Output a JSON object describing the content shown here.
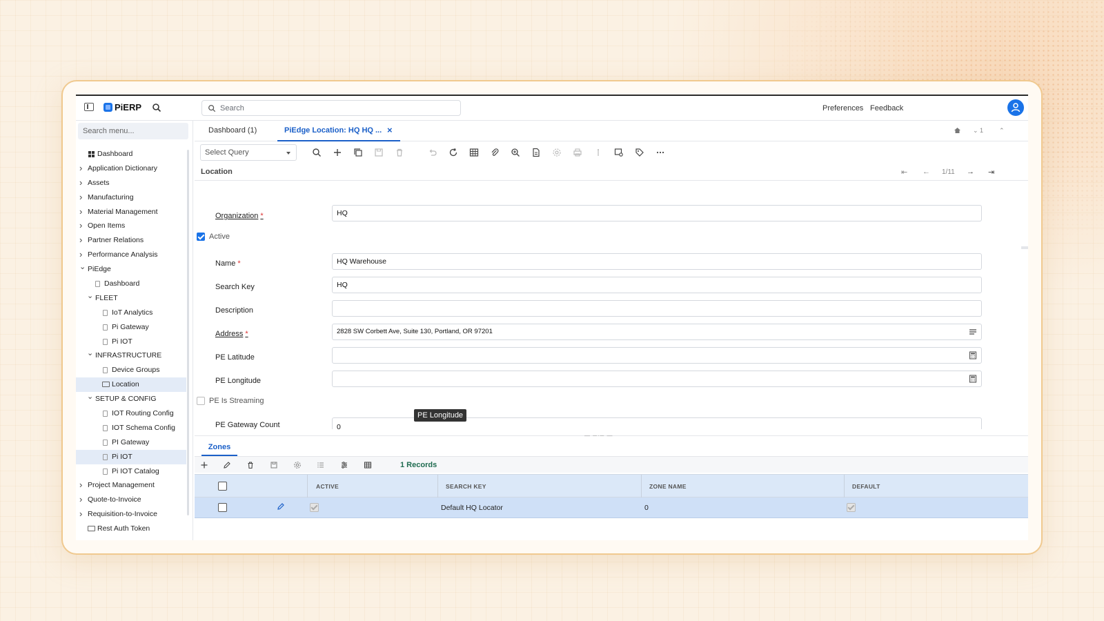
{
  "app": {
    "name": "PiERP"
  },
  "topbar": {
    "search_placeholder": "Search",
    "preferences": "Preferences",
    "feedback": "Feedback"
  },
  "sidebar": {
    "search_placeholder": "Search menu...",
    "items": [
      {
        "label": "Dashboard",
        "level": 0,
        "icon": "grid-icon"
      },
      {
        "label": "Application Dictionary",
        "level": 0,
        "icon": "chevron-right-icon"
      },
      {
        "label": "Assets",
        "level": 0,
        "icon": "chevron-right-icon"
      },
      {
        "label": "Manufacturing",
        "level": 0,
        "icon": "chevron-right-icon"
      },
      {
        "label": "Material Management",
        "level": 0,
        "icon": "chevron-right-icon"
      },
      {
        "label": "Open Items",
        "level": 0,
        "icon": "chevron-right-icon"
      },
      {
        "label": "Partner Relations",
        "level": 0,
        "icon": "chevron-right-icon"
      },
      {
        "label": "Performance Analysis",
        "level": 0,
        "icon": "chevron-right-icon"
      },
      {
        "label": "PiEdge",
        "level": 0,
        "icon": "chevron-down-icon"
      },
      {
        "label": "Dashboard",
        "level": 1,
        "icon": "document-icon"
      },
      {
        "label": "FLEET",
        "level": 1,
        "icon": "chevron-down-icon"
      },
      {
        "label": "IoT Analytics",
        "level": 2,
        "icon": "document-icon"
      },
      {
        "label": "Pi Gateway",
        "level": 2,
        "icon": "document-icon"
      },
      {
        "label": "Pi IOT",
        "level": 2,
        "icon": "document-icon"
      },
      {
        "label": "INFRASTRUCTURE",
        "level": 1,
        "icon": "chevron-down-icon"
      },
      {
        "label": "Device Groups",
        "level": 2,
        "icon": "document-icon"
      },
      {
        "label": "Location",
        "level": 2,
        "icon": "window-icon",
        "selected": true
      },
      {
        "label": "SETUP & CONFIG",
        "level": 1,
        "icon": "chevron-down-icon"
      },
      {
        "label": "IOT Routing Config",
        "level": 2,
        "icon": "document-icon"
      },
      {
        "label": "IOT Schema Config",
        "level": 2,
        "icon": "document-icon"
      },
      {
        "label": "PI Gateway",
        "level": 2,
        "icon": "document-icon"
      },
      {
        "label": "Pi IOT",
        "level": 2,
        "icon": "document-icon",
        "selected": true
      },
      {
        "label": "Pi IOT Catalog",
        "level": 2,
        "icon": "document-icon"
      },
      {
        "label": "Project Management",
        "level": 0,
        "icon": "chevron-right-icon"
      },
      {
        "label": "Quote-to-Invoice",
        "level": 0,
        "icon": "chevron-right-icon"
      },
      {
        "label": "Requisition-to-Invoice",
        "level": 0,
        "icon": "chevron-right-icon"
      },
      {
        "label": "Rest Auth Token",
        "level": 0,
        "icon": "window-icon"
      }
    ]
  },
  "tabs": {
    "dashboard": "Dashboard (1)",
    "active": "PiEdge Location: HQ HQ ...",
    "window_count": "1"
  },
  "toolbar": {
    "select_query": "Select Query"
  },
  "record": {
    "breadcrumb": "Location",
    "position": "1/11"
  },
  "form": {
    "organization_label": "Organization",
    "organization_value": "HQ",
    "active_label": "Active",
    "active_checked": true,
    "name_label": "Name",
    "name_value": "HQ Warehouse",
    "search_key_label": "Search Key",
    "search_key_value": "HQ",
    "description_label": "Description",
    "description_value": "",
    "address_label": "Address",
    "address_value": "2828 SW Corbett Ave, Suite 130, Portland, OR 97201",
    "latitude_label": "PE Latitude",
    "latitude_value": "",
    "longitude_label": "PE Longitude",
    "longitude_value": "",
    "tooltip": "PE Longitude",
    "streaming_label": "PE Is Streaming",
    "streaming_checked": false,
    "gateway_count_label": "PE Gateway Count",
    "gateway_count_value": "0",
    "required_mark": "*"
  },
  "detail": {
    "tab": "Zones",
    "records": "1 Records",
    "columns": [
      "ACTIVE",
      "SEARCH KEY",
      "ZONE NAME",
      "DEFAULT"
    ],
    "rows": [
      {
        "active": true,
        "search_key": "Default HQ Locator",
        "zone_name": "0",
        "default": true
      }
    ]
  },
  "colors": {
    "accent": "#1a73e8",
    "tab_active": "#1a5fc8",
    "records_text": "#1e6b4f",
    "grid_header": "#dbe8f8",
    "selected_row": "#cfe0f7"
  }
}
